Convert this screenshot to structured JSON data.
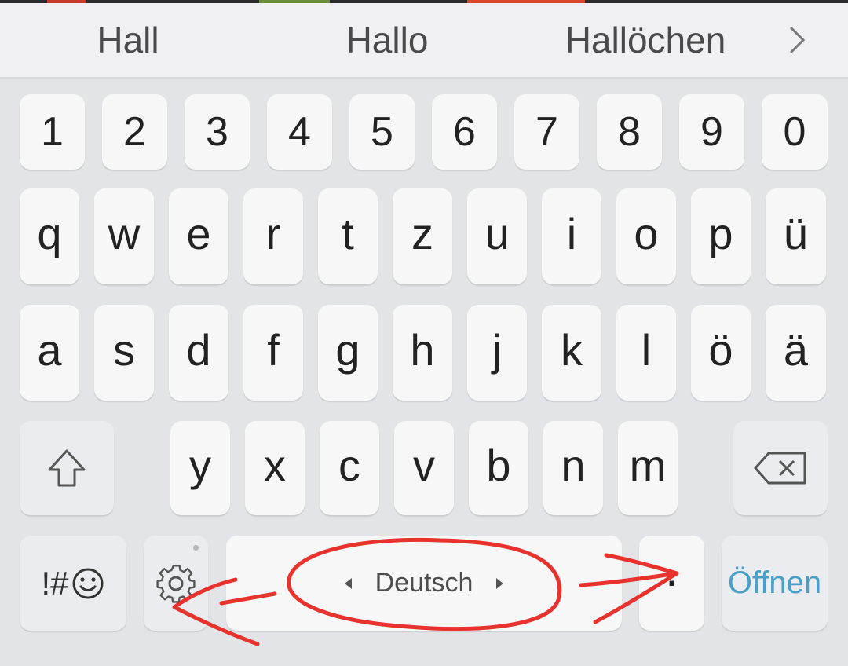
{
  "suggestions": [
    "Hall",
    "Hallo",
    "Hallöchen"
  ],
  "number_row": [
    "1",
    "2",
    "3",
    "4",
    "5",
    "6",
    "7",
    "8",
    "9",
    "0"
  ],
  "row1": [
    "q",
    "w",
    "e",
    "r",
    "t",
    "z",
    "u",
    "i",
    "o",
    "p",
    "ü"
  ],
  "row2": [
    "a",
    "s",
    "d",
    "f",
    "g",
    "h",
    "j",
    "k",
    "l",
    "ö",
    "ä"
  ],
  "row3": [
    "y",
    "x",
    "c",
    "v",
    "b",
    "n",
    "m"
  ],
  "bottom": {
    "symbols_label": "!#",
    "space_label": "Deutsch",
    "period_label": ".",
    "enter_label": "Öffnen"
  },
  "icons": {
    "suggestion_more": "chevron-right-icon",
    "shift": "shift-arrow-icon",
    "backspace": "backspace-icon",
    "emoji": "smiley-icon",
    "settings": "gear-icon"
  },
  "colors": {
    "keyboard_bg": "#e3e4e8",
    "key_bg": "#f7f7f8",
    "enter_text": "#4a9fc7",
    "annotation": "#e8322d"
  }
}
